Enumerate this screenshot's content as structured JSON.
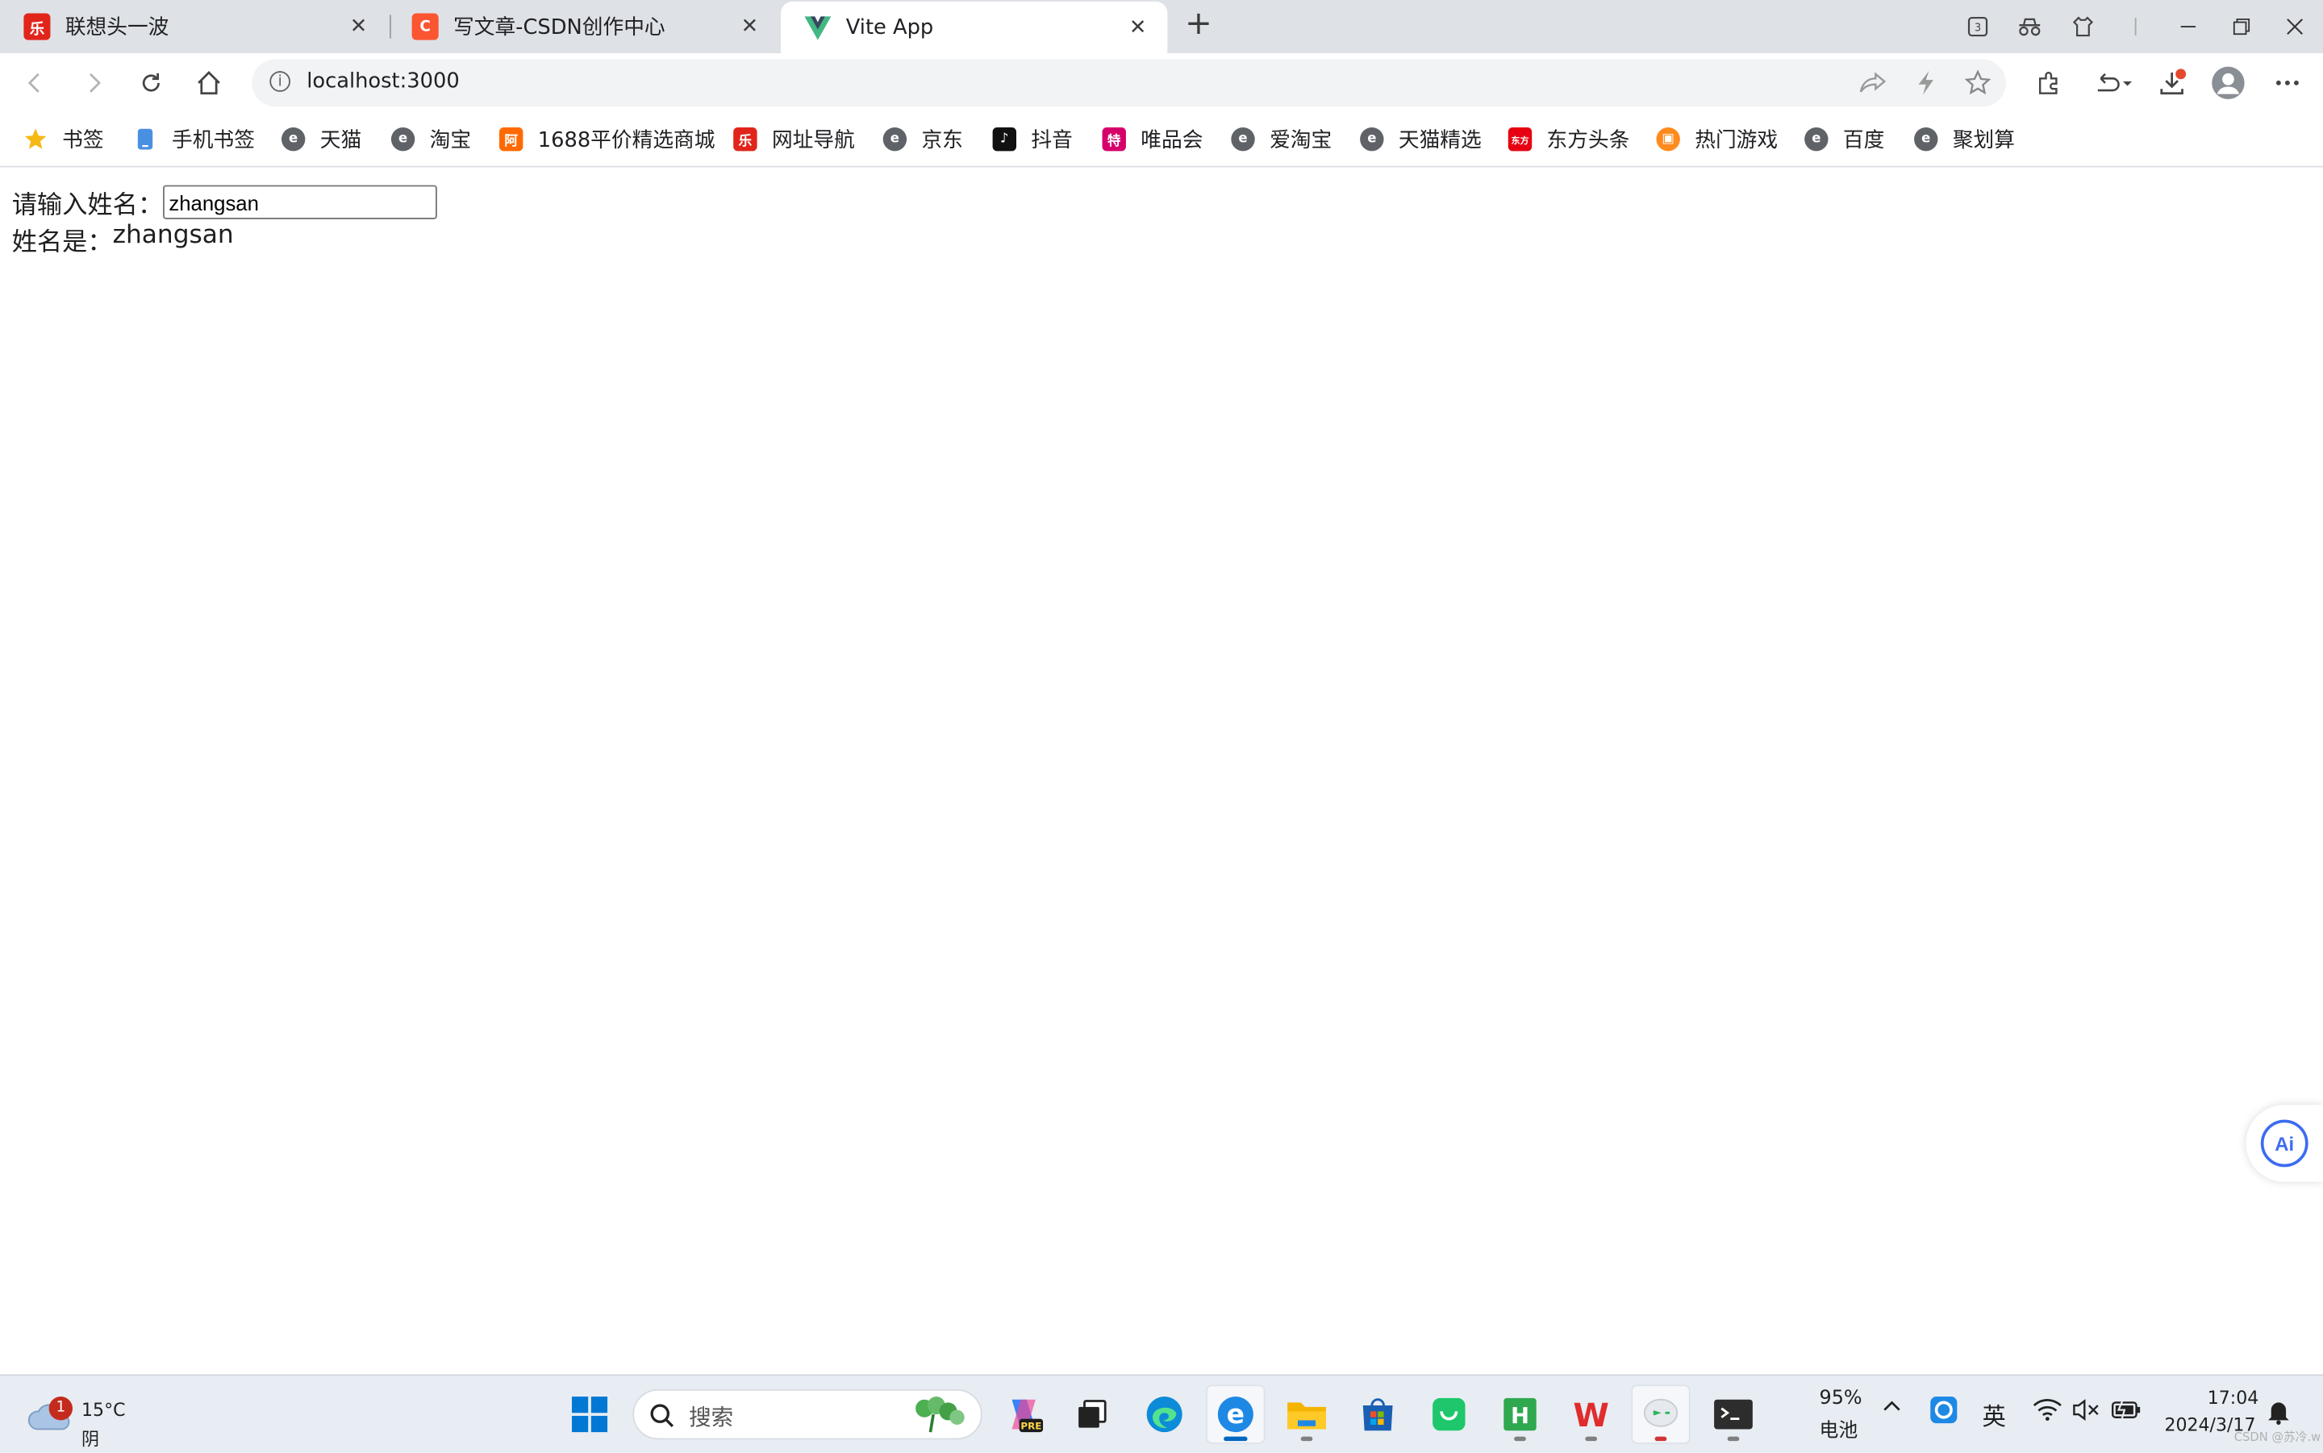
{
  "browser": {
    "tabs": [
      {
        "title": "联想头一波",
        "icon": "lenovo-icon",
        "color": "#e1251b",
        "active": false
      },
      {
        "title": "写文章-CSDN创作中心",
        "icon": "csdn-icon",
        "color": "#fc5531",
        "active": false
      },
      {
        "title": "Vite App",
        "icon": "vue-icon",
        "color": "#41b883",
        "active": true
      }
    ],
    "address": {
      "url": "localhost:3000"
    },
    "bookmarks": [
      {
        "label": "书签",
        "icon": "star-icon"
      },
      {
        "label": "手机书签",
        "icon": "phone-icon"
      },
      {
        "label": "天猫",
        "icon": "e-icon"
      },
      {
        "label": "淘宝",
        "icon": "e-icon"
      },
      {
        "label": "1688平价精选商城",
        "icon": "1688-icon"
      },
      {
        "label": "网址导航",
        "icon": "lenovo-icon"
      },
      {
        "label": "京东",
        "icon": "e-icon"
      },
      {
        "label": "抖音",
        "icon": "douyin-icon"
      },
      {
        "label": "唯品会",
        "icon": "vip-icon"
      },
      {
        "label": "爱淘宝",
        "icon": "e-icon"
      },
      {
        "label": "天猫精选",
        "icon": "e-icon"
      },
      {
        "label": "东方头条",
        "icon": "dongfang-icon"
      },
      {
        "label": "热门游戏",
        "icon": "game-icon"
      },
      {
        "label": "百度",
        "icon": "e-icon"
      },
      {
        "label": "聚划算",
        "icon": "e-icon"
      }
    ],
    "extension_badge": "3"
  },
  "page": {
    "input_label": "请输入姓名：",
    "input_value": "zhangsan",
    "result_label": "姓名是：",
    "result_value": "zhangsan",
    "ai_button": "Ai"
  },
  "taskbar": {
    "weather": {
      "temp": "15°C",
      "desc": "阴",
      "badge": "1"
    },
    "search_placeholder": "搜索",
    "battery_percent": "95%",
    "battery_label": "电池",
    "ime": "英",
    "time": "17:04",
    "date": "2024/3/17",
    "wps_label": "W",
    "hbuilder_label": "H",
    "pre_label": "PRE"
  },
  "watermark": "CSDN @苏冷.w"
}
